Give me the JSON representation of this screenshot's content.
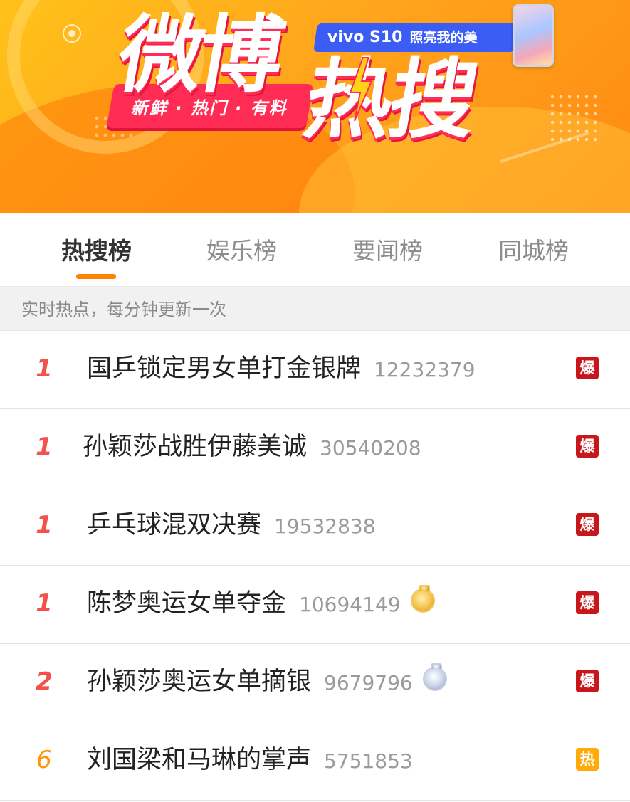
{
  "banner": {
    "logo_line1": "微博",
    "logo_line2": "热搜",
    "slogan": "新鲜 · 热门 · 有料",
    "ad_brand": "vivo S10",
    "ad_slogan": "照亮我的美"
  },
  "tabs": [
    {
      "label": "热搜榜",
      "active": true
    },
    {
      "label": "娱乐榜",
      "active": false
    },
    {
      "label": "要闻榜",
      "active": false
    },
    {
      "label": "同城榜",
      "active": false
    }
  ],
  "subheader": "实时热点，每分钟更新一次",
  "items": [
    {
      "rank": "1",
      "title": "国乒锁定男女单打金银牌",
      "count": "12232379",
      "medal": "",
      "badge": "爆"
    },
    {
      "rank": "1",
      "title": "孙颖莎战胜伊藤美诚",
      "count": "30540208",
      "medal": "",
      "badge": "爆"
    },
    {
      "rank": "1",
      "title": "乒乓球混双决赛",
      "count": "19532838",
      "medal": "",
      "badge": "爆"
    },
    {
      "rank": "1",
      "title": "陈梦奥运女单夺金",
      "count": "10694149",
      "medal": "gold-medal",
      "badge": "爆"
    },
    {
      "rank": "2",
      "title": "孙颖莎奥运女单摘银",
      "count": "9679796",
      "medal": "silver-medal",
      "badge": "爆"
    },
    {
      "rank": "6",
      "title": "刘国梁和马琳的掌声",
      "count": "5751853",
      "medal": "",
      "badge": "热"
    }
  ],
  "colors": {
    "accent_orange": "#ff8200",
    "rank_red": "#f4514d",
    "rank_orange": "#ff9406",
    "badge_bao": "#c7171a",
    "badge_re": "#ffab0a"
  }
}
